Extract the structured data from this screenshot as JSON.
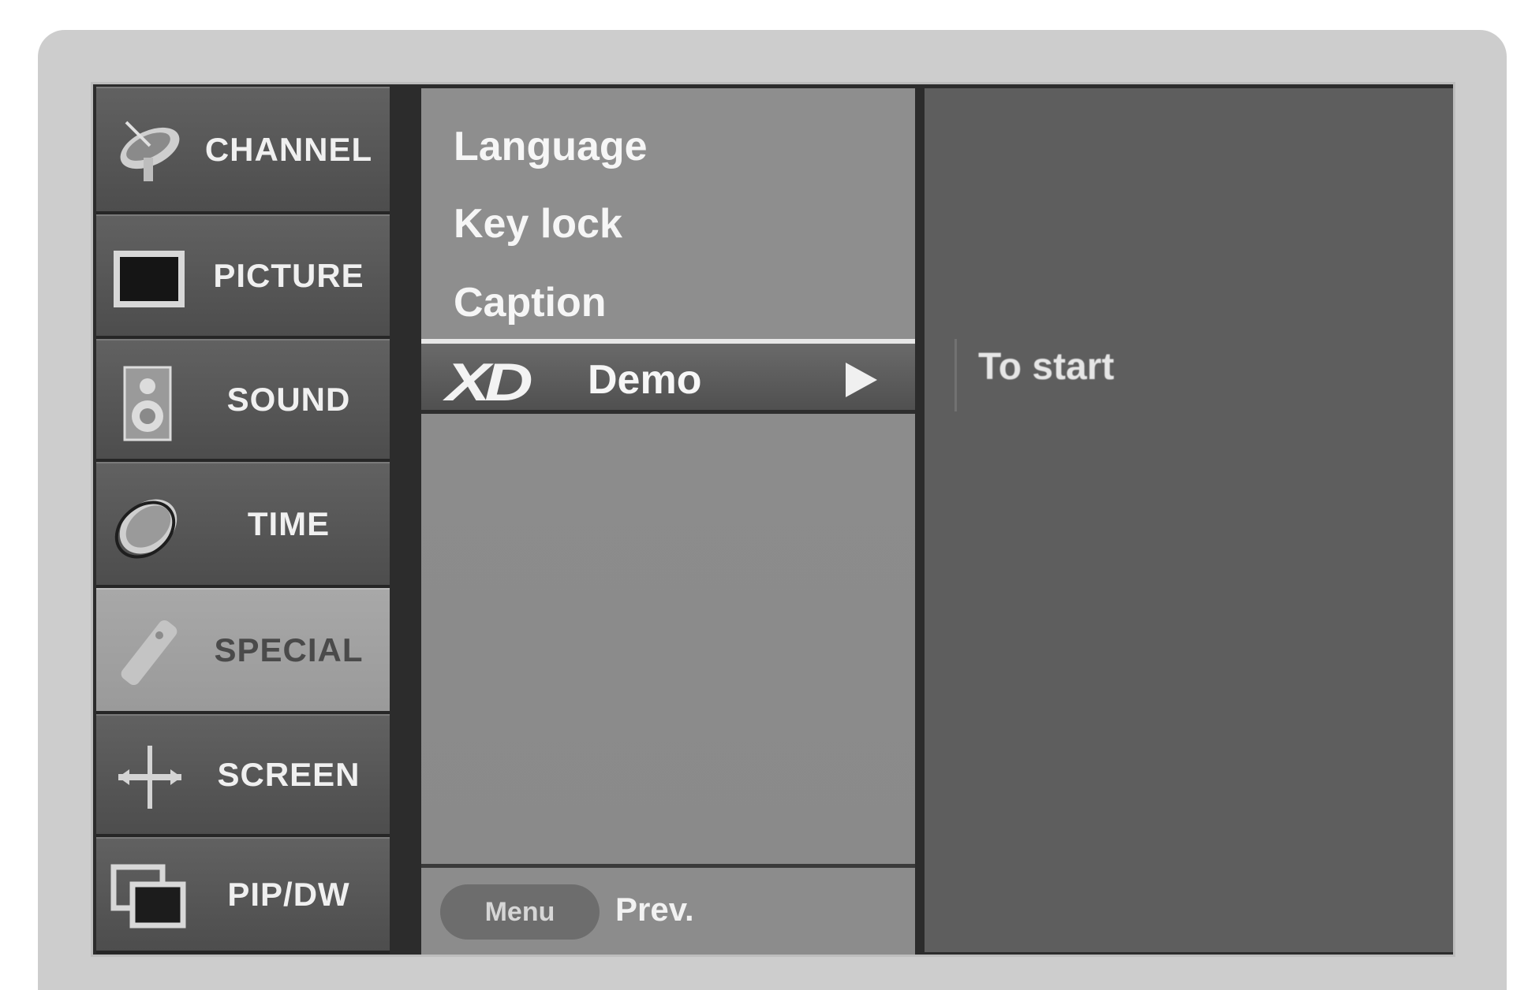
{
  "categories": [
    {
      "label": "CHANNEL",
      "icon": "satellite-dish-icon"
    },
    {
      "label": "PICTURE",
      "icon": "tv-screen-icon"
    },
    {
      "label": "SOUND",
      "icon": "speaker-icon"
    },
    {
      "label": "TIME",
      "icon": "clock-icon"
    },
    {
      "label": "SPECIAL",
      "icon": "remote-control-icon"
    },
    {
      "label": "SCREEN",
      "icon": "screen-adjust-icon"
    },
    {
      "label": "PIP/DW",
      "icon": "pip-windows-icon"
    }
  ],
  "active_category": "SPECIAL",
  "submenu": {
    "items": [
      "Language",
      "Key lock",
      "Caption"
    ],
    "selected": {
      "logo": "XD",
      "label": "Demo",
      "arrow": "▶"
    }
  },
  "footer": {
    "menu_button": "Menu",
    "prev_label": "Prev."
  },
  "info": {
    "text": "To start"
  }
}
